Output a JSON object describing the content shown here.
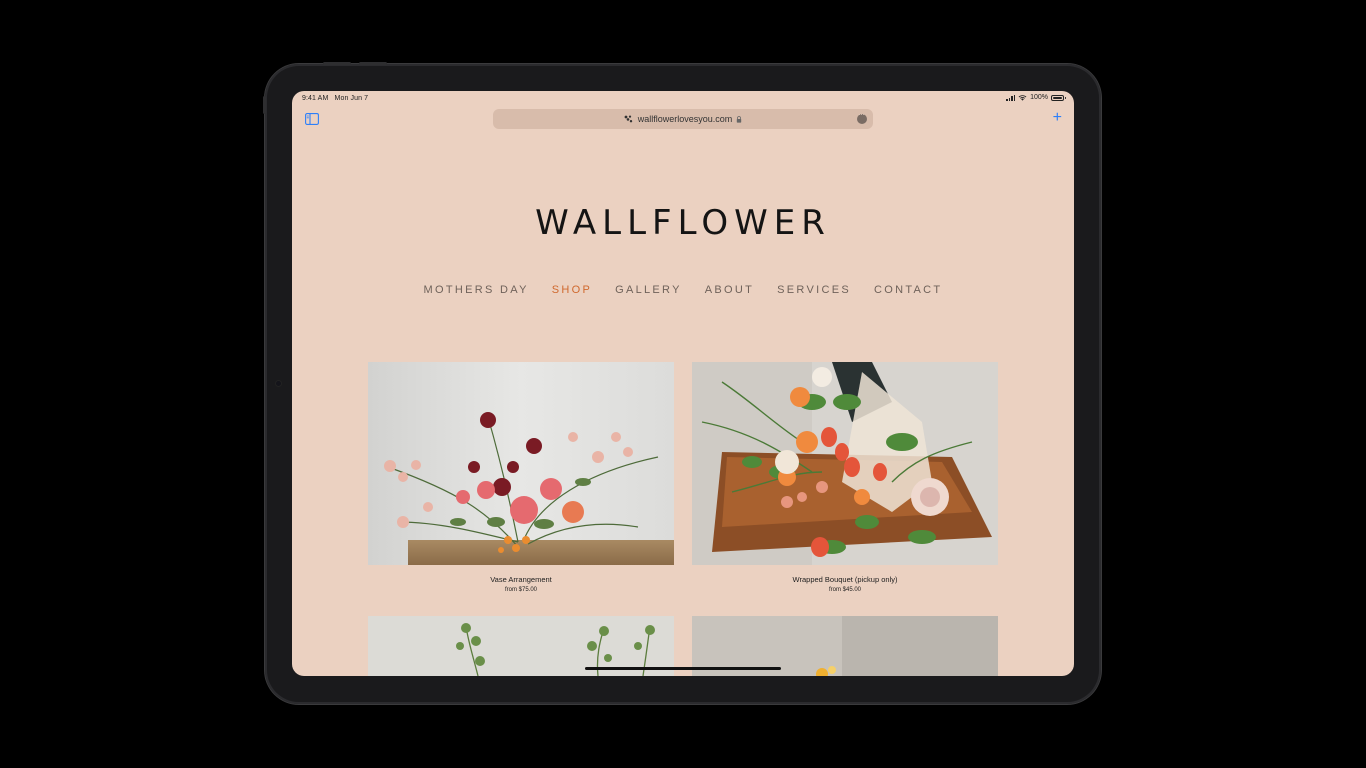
{
  "status_bar": {
    "time": "9:41 AM",
    "date": "Mon Jun 7",
    "battery": "100%"
  },
  "browser": {
    "url": "wallflowerlovesyou.com",
    "icons": {
      "sidebar": "sidebar-icon",
      "site": "site-icon",
      "lock": "lock-icon",
      "more": "more-icon",
      "add_tab": "plus-icon"
    },
    "add_tab_label": "+"
  },
  "site": {
    "logo": "WALLFLOWER",
    "nav": [
      {
        "label": "MOTHERS DAY",
        "active": false
      },
      {
        "label": "SHOP",
        "active": true
      },
      {
        "label": "GALLERY",
        "active": false
      },
      {
        "label": "ABOUT",
        "active": false
      },
      {
        "label": "SERVICES",
        "active": false
      },
      {
        "label": "CONTACT",
        "active": false
      }
    ],
    "products": [
      {
        "name": "Vase Arrangement",
        "price": "from $75.00"
      },
      {
        "name": "Wrapped Bouquet (pickup only)",
        "price": "from $45.00"
      }
    ]
  },
  "colors": {
    "page_background": "#ebd1c1",
    "nav_text": "#6f625a",
    "nav_active": "#d0692e",
    "browser_accent": "#2d7ff9"
  }
}
